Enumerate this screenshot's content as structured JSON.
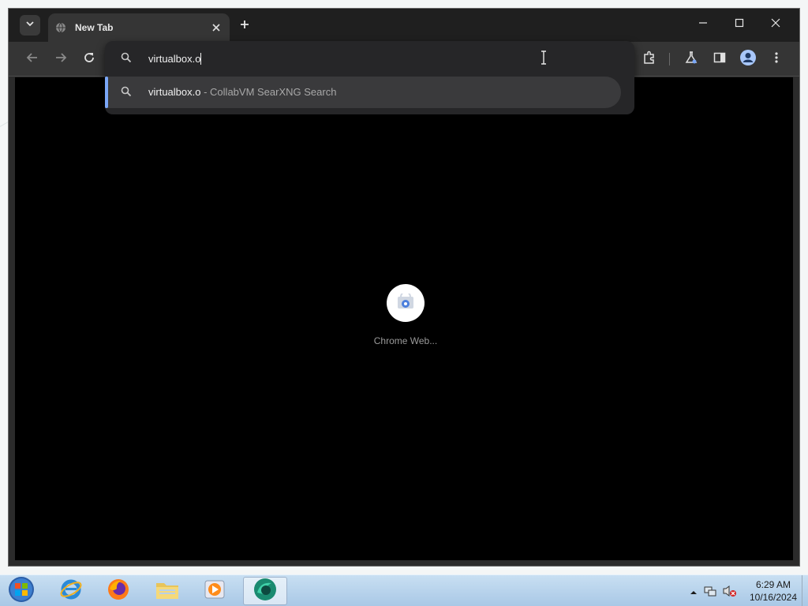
{
  "browser": {
    "tab": {
      "title": "New Tab"
    },
    "omnibox": {
      "input_value": "virtualbox.o",
      "suggestion": {
        "query": "virtualbox.o",
        "separator": " - ",
        "engine": "CollabVM SearXNG Search"
      }
    },
    "shortcut": {
      "label": "Chrome Web..."
    }
  },
  "taskbar": {
    "apps": [
      "internet-explorer",
      "firefox",
      "file-explorer",
      "media-player",
      "chrome-like-browser"
    ],
    "clock": {
      "time": "6:29 AM",
      "date": "10/16/2024"
    }
  },
  "colors": {
    "accent": "#7aa7f7",
    "toolbar": "#353535",
    "tabstrip": "#1f1f1f",
    "content": "#000000"
  }
}
